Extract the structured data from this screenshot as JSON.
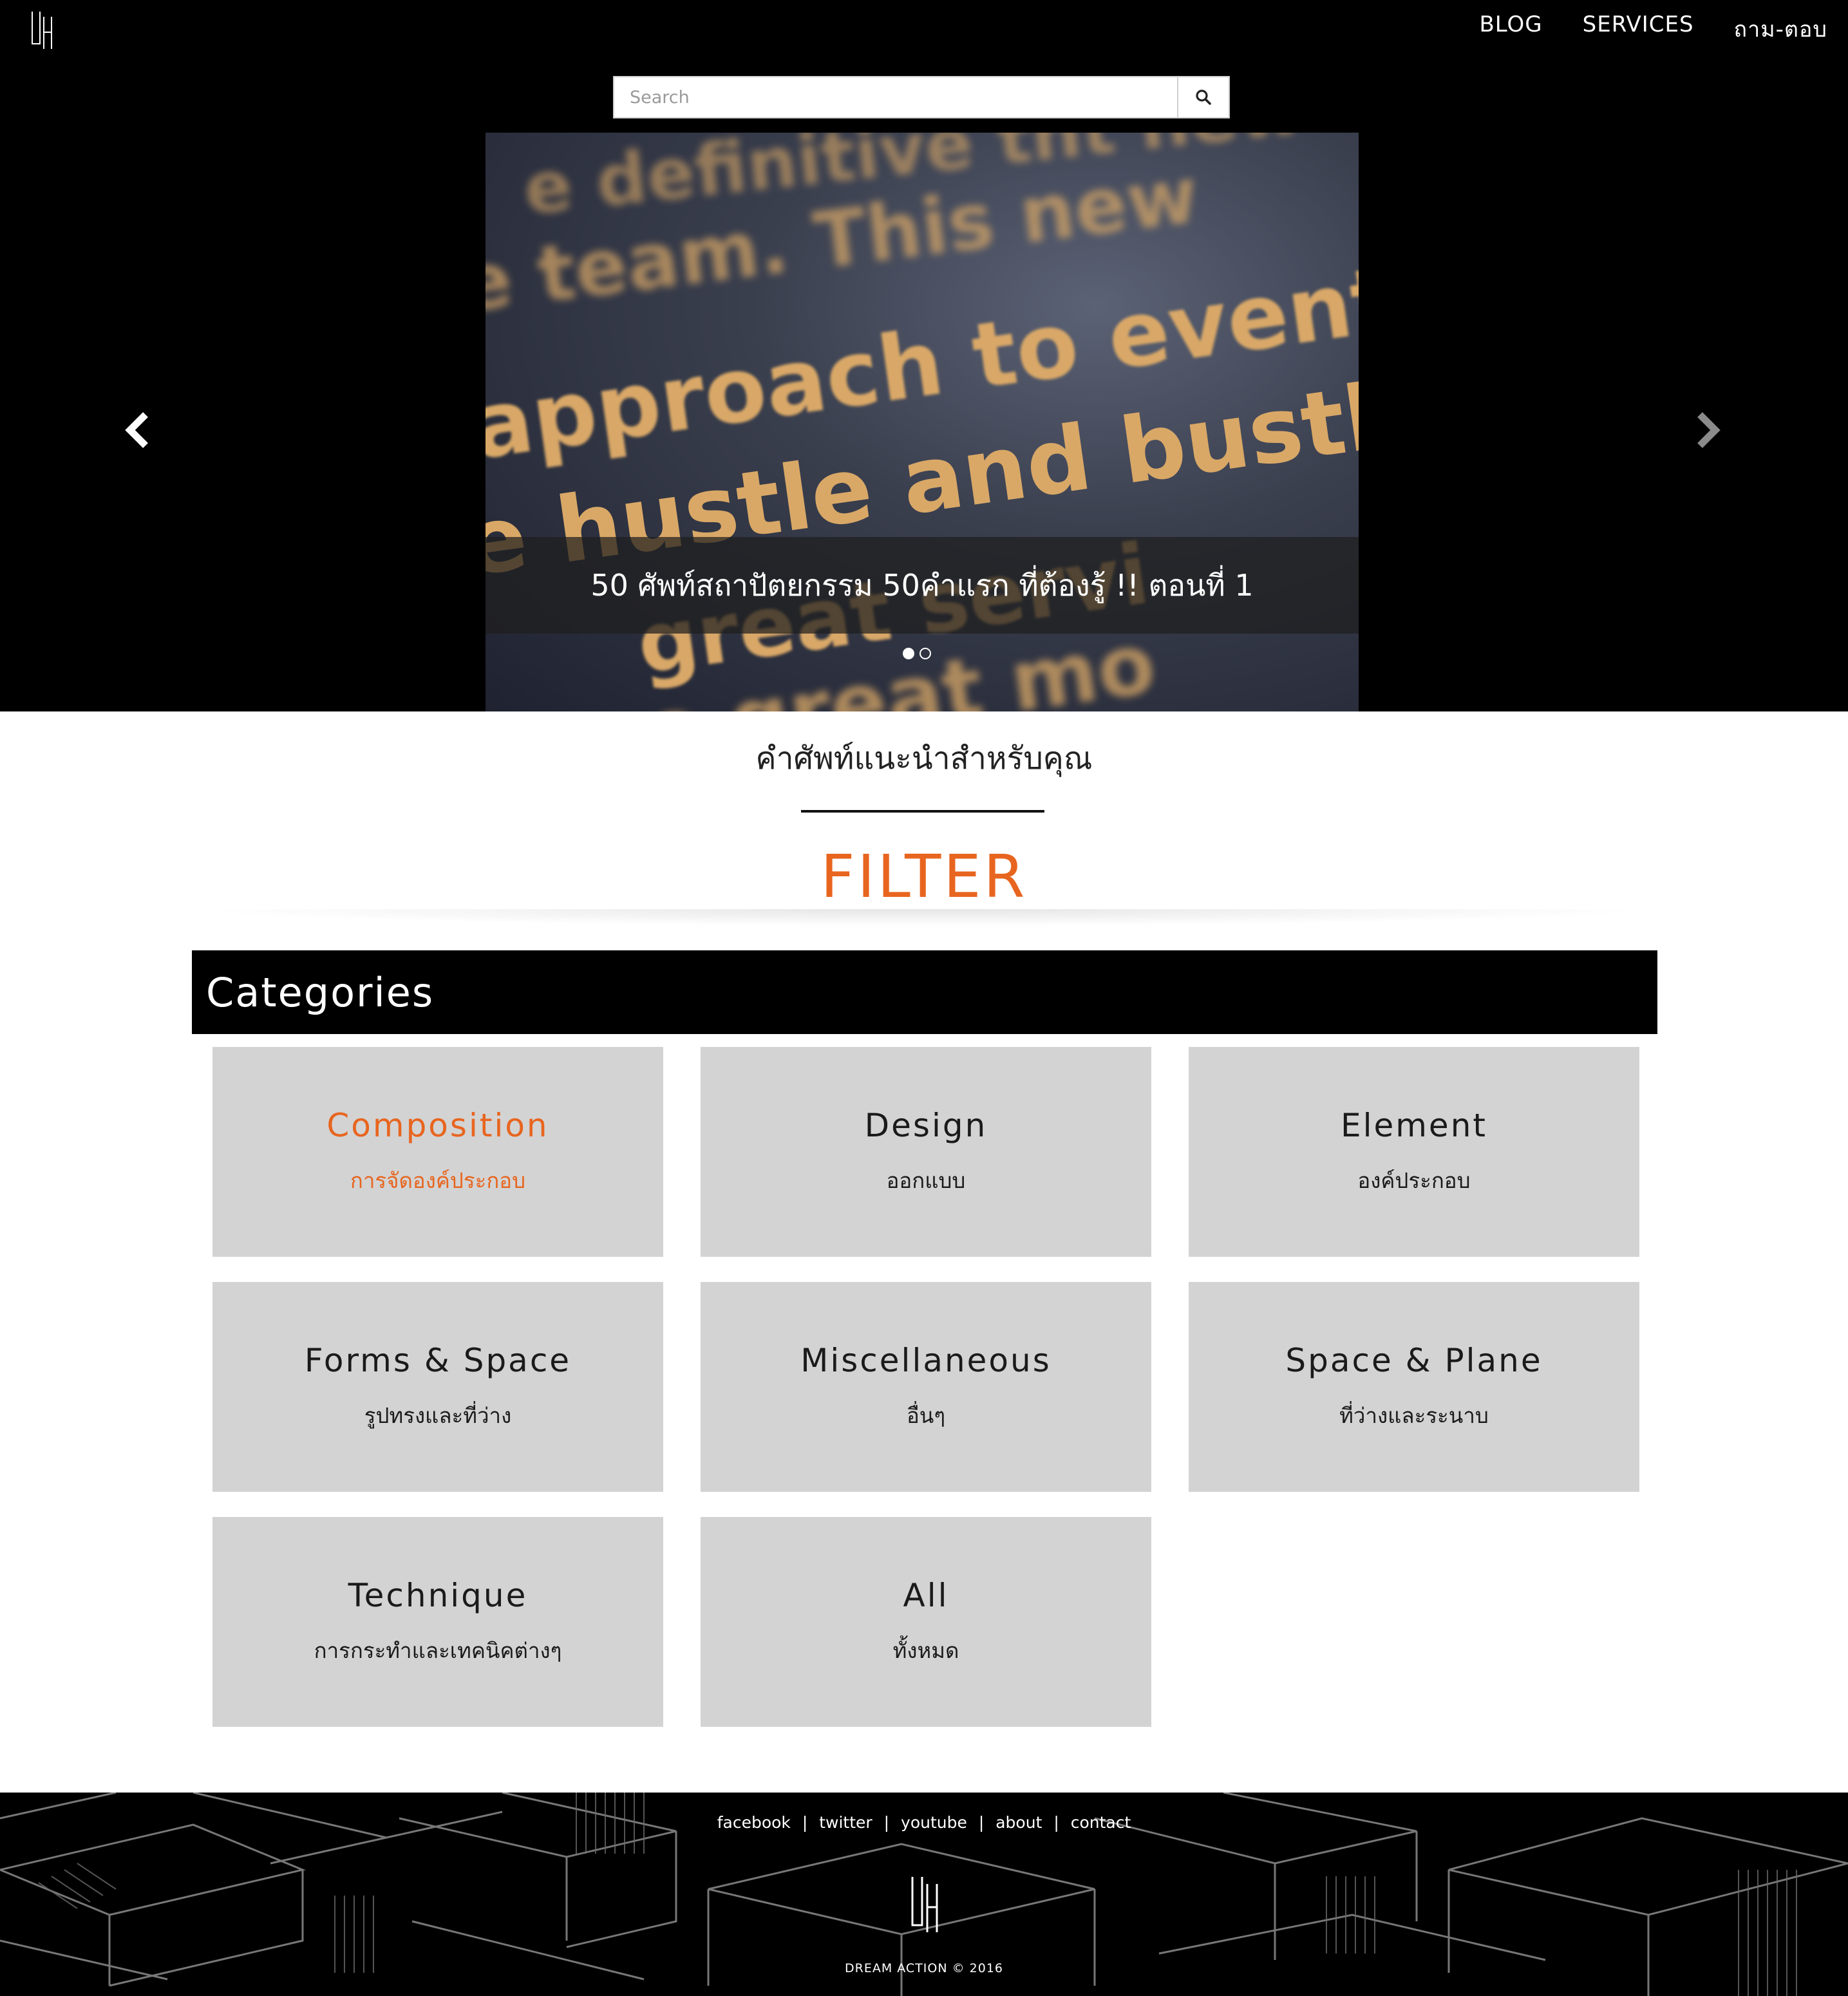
{
  "header": {
    "nav": [
      "BLOG",
      "SERVICES",
      "ถาม-ตอบ"
    ]
  },
  "search": {
    "placeholder": "Search",
    "value": ""
  },
  "slider": {
    "caption": "50 ศัพท์สถาปัตยกรรม 50คำแรก ที่ต้องรู้ !! ตอนที่ 1",
    "slide_count": 2,
    "active_slide": 1
  },
  "intro": {
    "subtitle": "คำศัพท์แนะนำสำหรับคุณ",
    "filter_title": "FILTER"
  },
  "categories": {
    "heading": "Categories",
    "items": [
      {
        "en": "Composition",
        "th": "การจัดองค์ประกอบ",
        "active": true
      },
      {
        "en": "Design",
        "th": "ออกแบบ",
        "active": false
      },
      {
        "en": "Element",
        "th": "องค์ประกอบ",
        "active": false
      },
      {
        "en": "Forms & Space",
        "th": "รูปทรงและที่ว่าง",
        "active": false
      },
      {
        "en": "Miscellaneous",
        "th": "อื่นๆ",
        "active": false
      },
      {
        "en": "Space & Plane",
        "th": "ที่ว่างและระนาบ",
        "active": false
      },
      {
        "en": "Technique",
        "th": "การกระทำและเทคนิคต่างๆ",
        "active": false
      },
      {
        "en": "All",
        "th": "ทั้งหมด",
        "active": false
      }
    ]
  },
  "footer": {
    "links": [
      "facebook",
      "twitter",
      "youtube",
      "about",
      "contact"
    ],
    "separator": "|",
    "copyright": "DREAM ACTION © 2016"
  },
  "colors": {
    "accent": "#e8651f",
    "tile_bg": "#d3d3d3",
    "dark": "#000000"
  }
}
